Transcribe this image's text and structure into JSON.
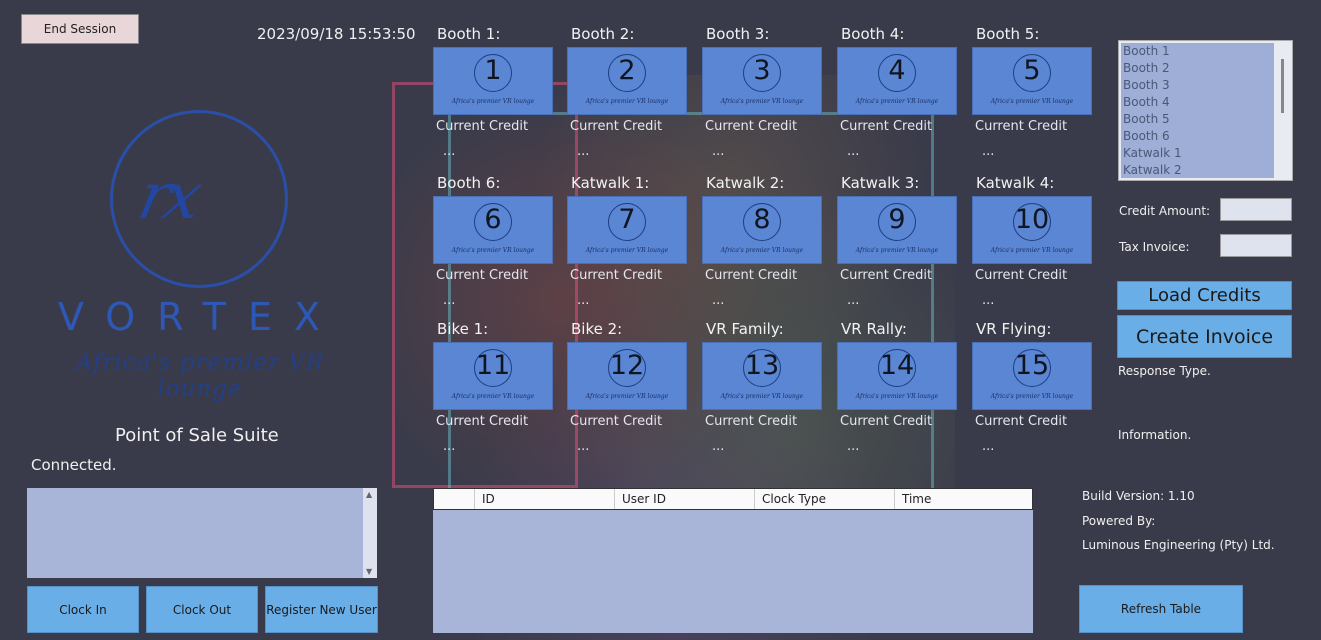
{
  "header": {
    "end_session_label": "End Session",
    "datetime": "2023/09/18 15:53:50"
  },
  "logo": {
    "mark": "rx",
    "wordmark": "VORTEX",
    "tagline": "Africa's premier VR lounge"
  },
  "left": {
    "title": "Point of Sale Suite",
    "status": "Connected.",
    "buttons": {
      "clock_in": "Clock In",
      "clock_out": "Clock Out",
      "register": "Register New User"
    }
  },
  "booths": [
    {
      "label": "Booth 1:",
      "number": "1",
      "credit_label": "Current Credit",
      "credit_value": "..."
    },
    {
      "label": "Booth 2:",
      "number": "2",
      "credit_label": "Current Credit",
      "credit_value": "..."
    },
    {
      "label": "Booth 3:",
      "number": "3",
      "credit_label": "Current Credit",
      "credit_value": "..."
    },
    {
      "label": "Booth 4:",
      "number": "4",
      "credit_label": "Current Credit",
      "credit_value": "..."
    },
    {
      "label": "Booth 5:",
      "number": "5",
      "credit_label": "Current Credit",
      "credit_value": "..."
    },
    {
      "label": "Booth 6:",
      "number": "6",
      "credit_label": "Current Credit",
      "credit_value": "..."
    },
    {
      "label": "Katwalk 1:",
      "number": "7",
      "credit_label": "Current Credit",
      "credit_value": "..."
    },
    {
      "label": "Katwalk 2:",
      "number": "8",
      "credit_label": "Current Credit",
      "credit_value": "..."
    },
    {
      "label": "Katwalk 3:",
      "number": "9",
      "credit_label": "Current Credit",
      "credit_value": "..."
    },
    {
      "label": "Katwalk 4:",
      "number": "10",
      "credit_label": "Current Credit",
      "credit_value": "..."
    },
    {
      "label": "Bike 1:",
      "number": "11",
      "credit_label": "Current Credit",
      "credit_value": "..."
    },
    {
      "label": "Bike 2:",
      "number": "12",
      "credit_label": "Current Credit",
      "credit_value": "..."
    },
    {
      "label": "VR Family:",
      "number": "13",
      "credit_label": "Current Credit",
      "credit_value": "..."
    },
    {
      "label": "VR Rally:",
      "number": "14",
      "credit_label": "Current Credit",
      "credit_value": "..."
    },
    {
      "label": "VR Flying:",
      "number": "15",
      "credit_label": "Current Credit",
      "credit_value": "..."
    }
  ],
  "tile_tagline": "Africa's premier VR lounge",
  "right": {
    "stations": [
      "Booth 1",
      "Booth 2",
      "Booth 3",
      "Booth 4",
      "Booth 5",
      "Booth 6",
      "Katwalk 1",
      "Katwalk 2"
    ],
    "credit_amount_label": "Credit Amount:",
    "tax_invoice_label": "Tax Invoice:",
    "credit_amount_value": "",
    "tax_invoice_value": "",
    "load_credits": "Load Credits",
    "create_invoice": "Create Invoice",
    "response_type": "Response Type.",
    "information": "Information.",
    "build_version": "Build Version: 1.10",
    "powered_by": "Powered By:",
    "company": "Luminous Engineering (Pty) Ltd.",
    "refresh_table": "Refresh Table"
  },
  "table": {
    "columns": [
      "ID",
      "User ID",
      "Clock Type",
      "Time"
    ],
    "rows": []
  },
  "colors": {
    "background": "#3a3b4a",
    "tile": "#5a86d4",
    "button": "#6aaee8",
    "panel": "#a8b4d8",
    "logo": "#2d58b8"
  }
}
